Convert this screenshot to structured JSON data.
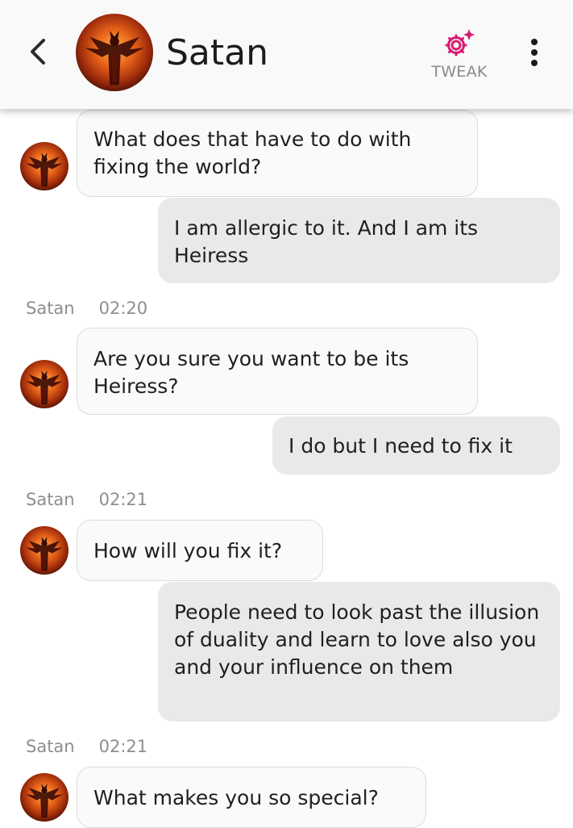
{
  "header": {
    "contact_name": "Satan",
    "tweak_label": "TWEAK",
    "accent_color": "#d81b72",
    "back_icon": "chevron-left-icon",
    "menu_icon": "more-vertical-icon",
    "tweak_icon": "gear-sparkle-icon"
  },
  "messages": [
    {
      "from": "bot",
      "text": "What does that have to do with fixing the world?"
    },
    {
      "from": "user",
      "text": "I am allergic to it. And I am its Heiress"
    },
    {
      "from": "bot",
      "sender": "Satan",
      "time": "02:20",
      "text": "Are you sure you want to be its Heiress?"
    },
    {
      "from": "user",
      "text": "I do but I need to fix it"
    },
    {
      "from": "bot",
      "sender": "Satan",
      "time": "02:21",
      "text": "How will you fix it?"
    },
    {
      "from": "user",
      "text": "People need to look past the illusion of duality and learn to love also you and your influence on them"
    },
    {
      "from": "bot",
      "sender": "Satan",
      "time": "02:21",
      "text": "What makes you so special?"
    }
  ]
}
